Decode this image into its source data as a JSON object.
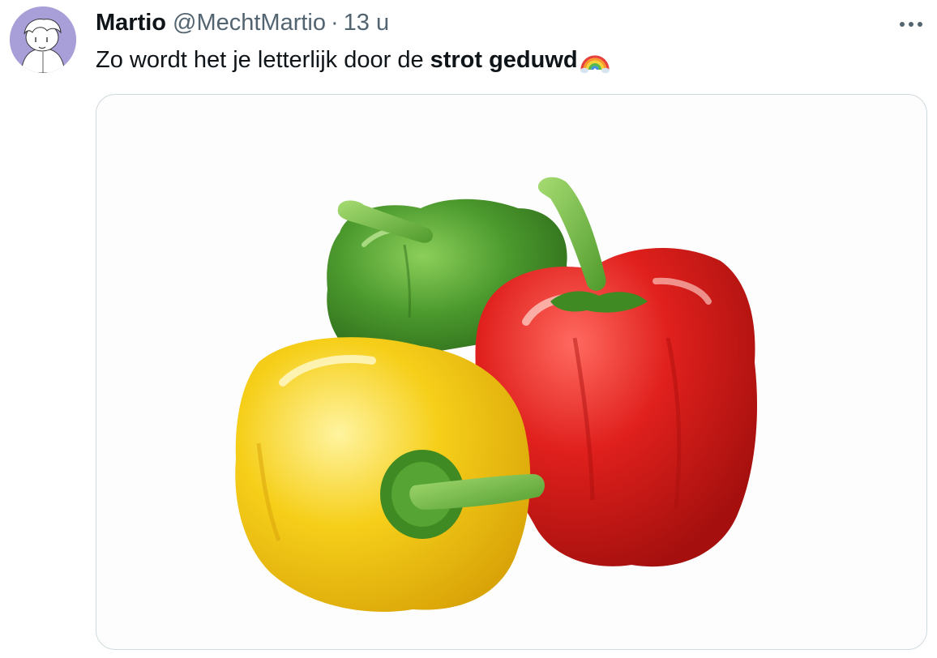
{
  "tweet": {
    "author": {
      "display_name": "Martio",
      "handle": "@MechtMartio"
    },
    "separator": "·",
    "time": "13 u",
    "text_prefix": "Zo wordt het je letterlijk door de",
    "text_bold": "strot geduwd",
    "emoji": "rainbow",
    "more_icon": "more-horizontal-icon",
    "media": {
      "subject": "three bell peppers: green, red, yellow"
    }
  },
  "colors": {
    "text_primary": "#0f1419",
    "text_secondary": "#536471",
    "border": "#cfd9de",
    "avatar_bg": "#a89fd8",
    "pepper_green": "#4c9a2e",
    "pepper_red": "#e0201d",
    "pepper_yellow": "#f6cf1a"
  }
}
